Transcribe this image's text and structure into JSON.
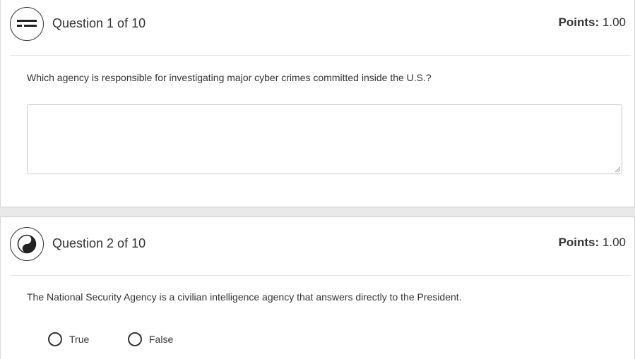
{
  "questions": [
    {
      "title": "Question 1 of 10",
      "icon": "unanswered-icon",
      "points_label": "Points:",
      "points_value": "1.00",
      "prompt": "Which agency is responsible for investigating major cyber crimes committed inside the U.S.?",
      "answer_value": ""
    },
    {
      "title": "Question 2 of 10",
      "icon": "half-answered-icon",
      "points_label": "Points:",
      "points_value": "1.00",
      "prompt": "The National Security Agency is a civilian intelligence agency that answers directly to the President.",
      "options": [
        "True",
        "False"
      ]
    }
  ]
}
